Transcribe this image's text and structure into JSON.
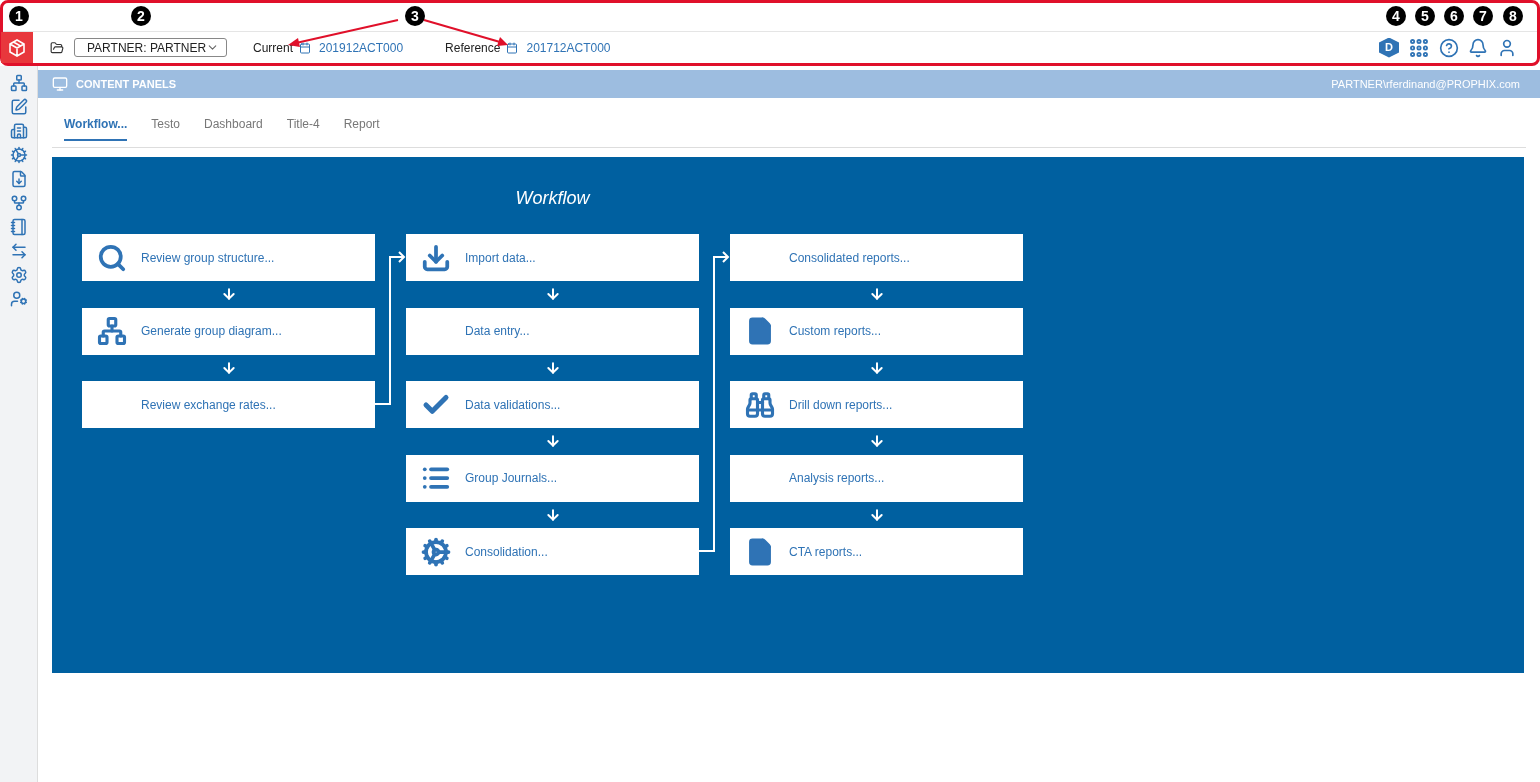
{
  "callouts": [
    {
      "label": "1"
    },
    {
      "label": "2"
    },
    {
      "label": "3"
    },
    {
      "label": "4"
    },
    {
      "label": "5"
    },
    {
      "label": "6"
    },
    {
      "label": "7"
    },
    {
      "label": "8"
    }
  ],
  "header": {
    "model": {
      "value": "PARTNER: PARTNER"
    },
    "current": {
      "label": "Current",
      "value": "201912ACT000"
    },
    "reference": {
      "label": "Reference",
      "value": "201712ACT000"
    },
    "user_badge": "D"
  },
  "content_panel": {
    "title": "CONTENT PANELS",
    "user": "PARTNER\\rferdinand@PROPHIX.com"
  },
  "tabs": [
    {
      "label": "Workflow...",
      "selected": true
    },
    {
      "label": "Testo",
      "selected": false
    },
    {
      "label": "Dashboard",
      "selected": false
    },
    {
      "label": "Title-4",
      "selected": false
    },
    {
      "label": "Report",
      "selected": false
    }
  ],
  "workflow": {
    "title": "Workflow",
    "columns": [
      {
        "steps": [
          {
            "label": "Review group structure..."
          },
          {
            "label": "Generate group diagram..."
          },
          {
            "label": "Review exchange rates..."
          }
        ]
      },
      {
        "steps": [
          {
            "label": "Import data..."
          },
          {
            "label": "Data entry..."
          },
          {
            "label": "Data validations..."
          },
          {
            "label": "Group Journals..."
          },
          {
            "label": "Consolidation..."
          }
        ]
      },
      {
        "steps": [
          {
            "label": "Consolidated reports..."
          },
          {
            "label": "Custom reports..."
          },
          {
            "label": "Drill down reports..."
          },
          {
            "label": "Analysis reports..."
          },
          {
            "label": "CTA reports..."
          }
        ]
      }
    ]
  }
}
